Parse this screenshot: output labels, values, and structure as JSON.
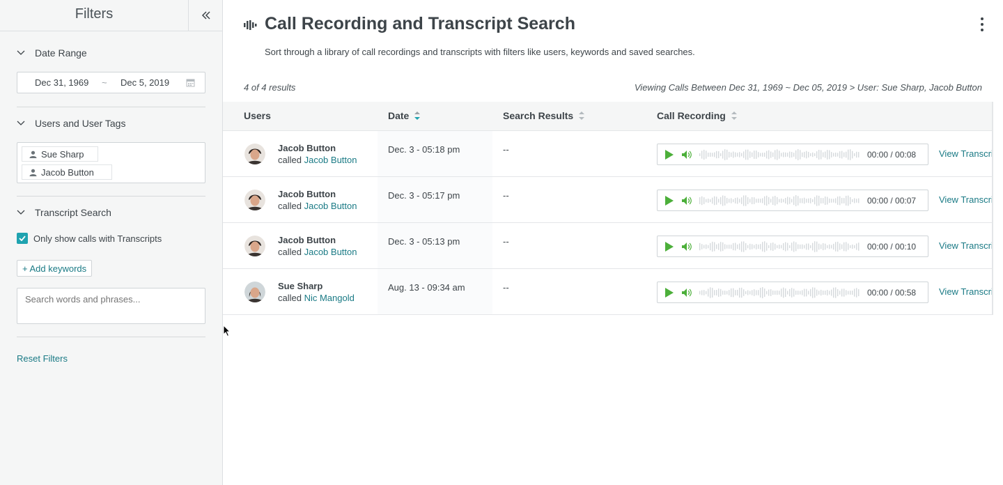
{
  "sidebar": {
    "title": "Filters",
    "sections": {
      "date_range": {
        "label": "Date Range",
        "start": "Dec 31, 1969",
        "separator": "~",
        "end": "Dec 5, 2019"
      },
      "users": {
        "label": "Users and User Tags",
        "tags": [
          "Sue Sharp",
          "Jacob Button"
        ]
      },
      "transcript": {
        "label": "Transcript Search",
        "checkbox_label": "Only show calls with Transcripts",
        "checkbox_checked": true,
        "add_keywords": "+ Add keywords",
        "placeholder": "Search words and phrases..."
      }
    },
    "reset": "Reset Filters"
  },
  "main": {
    "title": "Call Recording and Transcript Search",
    "subtitle": "Sort through a library of call recordings and transcripts with filters like users, keywords and saved searches.",
    "results_count": "4 of 4 results",
    "viewing": "Viewing Calls Between Dec 31, 1969 ~ Dec 05, 2019 > User: Sue Sharp, Jacob Button",
    "columns": [
      "Users",
      "Date",
      "Search Results",
      "Call Recording"
    ],
    "rows": [
      {
        "user": "Jacob Button",
        "called_prefix": "called",
        "called": "Jacob Button",
        "date": "Dec. 3 - 05:18 pm",
        "search": "--",
        "time": "00:00 / 00:08",
        "view": "View Transcript"
      },
      {
        "user": "Jacob Button",
        "called_prefix": "called",
        "called": "Jacob Button",
        "date": "Dec. 3 - 05:17 pm",
        "search": "--",
        "time": "00:00 / 00:07",
        "view": "View Transcript"
      },
      {
        "user": "Jacob Button",
        "called_prefix": "called",
        "called": "Jacob Button",
        "date": "Dec. 3 - 05:13 pm",
        "search": "--",
        "time": "00:00 / 00:10",
        "view": "View Transcript"
      },
      {
        "user": "Sue Sharp",
        "called_prefix": "called",
        "called": "Nic Mangold",
        "date": "Aug. 13 - 09:34 am",
        "search": "--",
        "time": "00:00 / 00:58",
        "view": "View Transcript"
      }
    ]
  },
  "colors": {
    "accent": "#1fa3b0",
    "link": "#1a7a85",
    "play": "#4caf3a"
  }
}
